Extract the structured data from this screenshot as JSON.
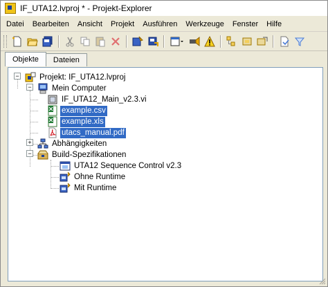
{
  "window": {
    "title": "IF_UTA12.lvproj * - Projekt-Explorer"
  },
  "menu": [
    "Datei",
    "Bearbeiten",
    "Ansicht",
    "Projekt",
    "Ausführen",
    "Werkzeuge",
    "Fenster",
    "Hilfe"
  ],
  "tabs": [
    {
      "label": "Objekte",
      "active": true
    },
    {
      "label": "Dateien",
      "active": false
    }
  ],
  "tree": {
    "root": "Projekt: IF_UTA12.lvproj",
    "computer": "Mein Computer",
    "items": [
      {
        "label": "IF_UTA12_Main_v2.3.vi",
        "icon": "vi-icon",
        "selected": false
      },
      {
        "label": "example.csv",
        "icon": "excel-file-icon",
        "selected": true
      },
      {
        "label": "example.xls",
        "icon": "excel-file-icon",
        "selected": true
      },
      {
        "label": "utacs_manual.pdf",
        "icon": "pdf-file-icon",
        "selected": true
      }
    ],
    "dependencies": "Abhängigkeiten",
    "build_specs": "Build-Spezifikationen",
    "build_items": [
      {
        "label": "UTA12 Sequence Control v2.3",
        "icon": "application-icon"
      },
      {
        "label": "Ohne Runtime",
        "icon": "installer-icon"
      },
      {
        "label": "Mit Runtime",
        "icon": "installer-icon"
      }
    ]
  },
  "colors": {
    "selection": "#316ac5",
    "panel_border": "#7f9db9",
    "chrome": "#ece9d8"
  }
}
